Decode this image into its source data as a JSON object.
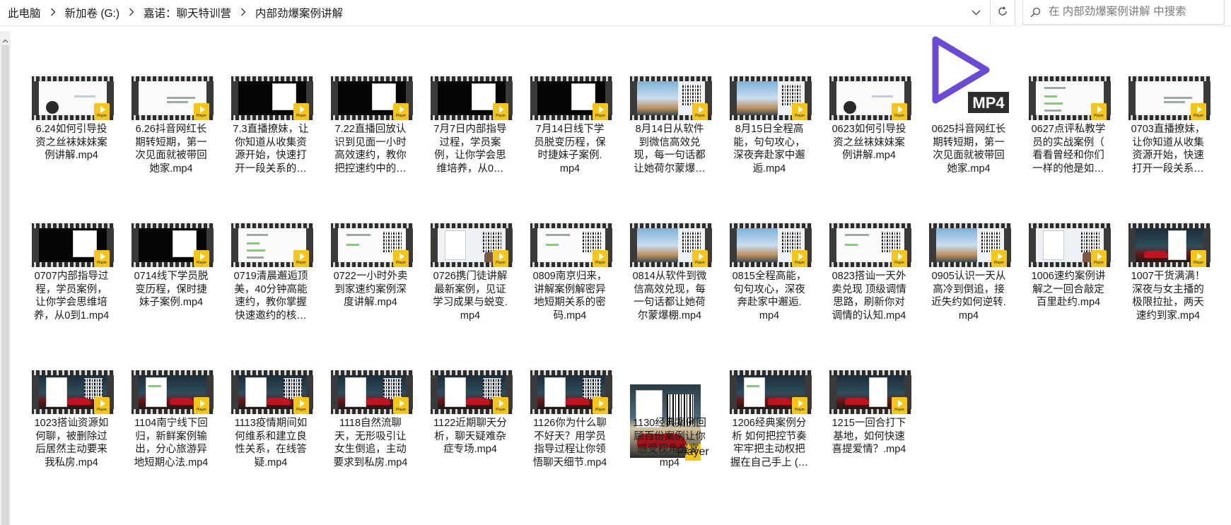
{
  "addressbar": {
    "breadcrumbs": [
      "此电脑",
      "新加卷 (G:)",
      "嘉诺：聊天特训营",
      "内部劲爆案例讲解"
    ],
    "search_placeholder": "在 内部劲爆案例讲解 中搜索"
  },
  "icons": {
    "separator": "chevron-right-icon",
    "dropdown": "chevron-down-icon",
    "refresh": "refresh-icon",
    "search": "search-icon",
    "file_badge": "player-badge-icon"
  },
  "colors": {
    "badge": "#f5c518",
    "mp4_icon": "#6b4bd6"
  },
  "files": [
    {
      "name": "6.24如何引导投资之丝袜妹妹案例讲解.mp4",
      "lines": [
        "6.24如何引导投",
        "资之丝袜妹妹案",
        "例讲解.mp4"
      ],
      "thumb": "white-face"
    },
    {
      "name": "6.26抖音网红长期转短期，第一次见面就被带回她家.mp4",
      "lines": [
        "6.26抖音网红长",
        "期转短期，第一",
        "次见面就被带回",
        "她家.mp4"
      ],
      "thumb": "white"
    },
    {
      "name": "7.3直播撩妹，让你知道从收集资源开始，快速打开一段关系的…",
      "lines": [
        "7.3直播撩妹，让",
        "你知道从收集资",
        "源开始，快速打",
        "开一段关系的…"
      ],
      "thumb": "black-panel"
    },
    {
      "name": "7.22直播回放认识到见面一小时高效速约，教你把控速约中的…",
      "lines": [
        "7.22直播回放认",
        "识到见面一小时",
        "高效速约，教你",
        "把控速约中的…"
      ],
      "thumb": "black-panel"
    },
    {
      "name": "7月7日内部指导过程，学员案例，让你学会思维培养，从0…",
      "lines": [
        "7月7日内部指导",
        "过程，学员案",
        "例，让你学会思",
        "维培养，从0…"
      ],
      "thumb": "black-panel"
    },
    {
      "name": "7月14日线下学员脱变历程，保时捷妹子案例.mp4",
      "lines": [
        "7月14日线下学",
        "员脱变历程，保",
        "时捷妹子案例.",
        "mp4"
      ],
      "thumb": "black-panel"
    },
    {
      "name": "8月14日从软件到微信高效兑现，每一句话都让她荷尔蒙爆…",
      "lines": [
        "8月14日从软件",
        "到微信高效兑",
        "现，每一句话都",
        "让她荷尔蒙爆…"
      ],
      "thumb": "sky-qr"
    },
    {
      "name": "8月15日全程高能，句句攻心，深夜奔赴家中邂逅.mp4",
      "lines": [
        "8月15日全程高",
        "能，句句攻心，",
        "深夜奔赴家中邂",
        "逅.mp4"
      ],
      "thumb": "sky-qr"
    },
    {
      "name": "0623如何引导投资之丝袜妹妹案例讲解.mp4",
      "lines": [
        "0623如何引导投",
        "资之丝袜妹妹案",
        "例讲解.mp4"
      ],
      "thumb": "white-face"
    },
    {
      "name": "0625抖音网红长期转短期，第一次见面就被带回她家.mp4",
      "lines": [
        "0625抖音网红长",
        "期转短期，第一",
        "次见面就被带回",
        "她家.mp4"
      ],
      "thumb": "mp4-icon",
      "mp4_label": "MP4"
    },
    {
      "name": "0627点评私教学员的实战案例（看看曾经和你们一样的他是如…",
      "lines": [
        "0627点评私教学",
        "员的实战案例（",
        "看看曾经和你们",
        "一样的他是如…"
      ],
      "thumb": "white-chat"
    },
    {
      "name": "0703直播撩妹，让你知道从收集资源开始，快速打开一段关系…",
      "lines": [
        "0703直播撩妹，",
        "让你知道从收集",
        "资源开始，快速",
        "打开一段关系…"
      ],
      "thumb": "white"
    },
    {
      "name": "0707内部指导过程，学员案例，让你学会思维培养，从0到1.mp4",
      "lines": [
        "0707内部指导过",
        "程，学员案例，",
        "让你学会思维培",
        "养，从0到1.mp4"
      ],
      "thumb": "black-panel"
    },
    {
      "name": "0714线下学员脱变历程，保时捷妹子案例.mp4",
      "lines": [
        "0714线下学员脱",
        "变历程，保时捷",
        "妹子案例.mp4"
      ],
      "thumb": "black-panel"
    },
    {
      "name": "0719清晨邂逅顶美，40分钟高能速约，教你掌握快速邀约的核…",
      "lines": [
        "0719清晨邂逅顶",
        "美，40分钟高能",
        "速约，教你掌握",
        "快速邀约的核…"
      ],
      "thumb": "white-chat"
    },
    {
      "name": "0722一小时外卖到家速约案例深度讲解.mp4",
      "lines": [
        "0722一小时外卖",
        "到家速约案例深",
        "度讲解.mp4"
      ],
      "thumb": "white-qr"
    },
    {
      "name": "0726携门徒讲解最新案例，见证学习成果与蜕变.mp4",
      "lines": [
        "0726携门徒讲解",
        "最新案例，见证",
        "学习成果与蜕变.",
        "mp4"
      ],
      "thumb": "screen-qr"
    },
    {
      "name": "0809南京归来，讲解案例解密异地短期关系的密码.mp4",
      "lines": [
        "0809南京归来，",
        "讲解案例解密异",
        "地短期关系的密",
        "码.mp4"
      ],
      "thumb": "white-qr"
    },
    {
      "name": "0814从软件到微信高效兑现，每一句话都让她荷尔蒙爆棚.mp4",
      "lines": [
        "0814从软件到微",
        "信高效兑现，每",
        "一句话都让她荷",
        "尔蒙爆棚.mp4"
      ],
      "thumb": "sky-qr"
    },
    {
      "name": "0815全程高能，句句攻心，深夜奔赴家中邂逅.mp4",
      "lines": [
        "0815全程高能，",
        "句句攻心，深夜",
        "奔赴家中邂逅.",
        "mp4"
      ],
      "thumb": "sky-qr"
    },
    {
      "name": "0823搭讪一天外卖兑现 顶级调情思路，刷新你对调情的认知.mp4",
      "lines": [
        "0823搭讪一天外",
        "卖兑现 顶级调情",
        "思路，刷新你对",
        "调情的认知.mp4"
      ],
      "thumb": "white-qr"
    },
    {
      "name": "0905认识一天从高冷到倒追，接近失约如何逆转.mp4",
      "lines": [
        "0905认识一天从",
        "高冷到倒追，接",
        "近失约如何逆转.",
        "mp4"
      ],
      "thumb": "sky-qr"
    },
    {
      "name": "1006速约案例讲解之一回合敲定百里赴约.mp4",
      "lines": [
        "1006速约案例讲",
        "解之一回合敲定",
        "百里赴约.mp4"
      ],
      "thumb": "screen-qr"
    },
    {
      "name": "1007干货满满！深夜与女主播的极限拉扯，两天速约到家.mp4",
      "lines": [
        "1007干货满满！",
        "深夜与女主播的",
        "极限拉扯，两天",
        "速约到家.mp4"
      ],
      "thumb": "car"
    },
    {
      "name": "1023搭讪资源如何聊，被删除过后居然主动要来我私房.mp4",
      "lines": [
        "1023搭讪资源如",
        "何聊，被删除过",
        "后居然主动要来",
        "我私房.mp4"
      ],
      "thumb": "car-qr"
    },
    {
      "name": "1104南宁线下回归，新鲜案例输出，分心旅游异地短期心法.mp4",
      "lines": [
        "1104南宁线下回",
        "归，新鲜案例输",
        "出，分心旅游异",
        "地短期心法.mp4"
      ],
      "thumb": "car-chat"
    },
    {
      "name": "1113疫情期间如何维系和建立良性关系，在线答疑.mp4",
      "lines": [
        "1113疫情期间如",
        "何维系和建立良",
        "性关系，在线答",
        "疑.mp4"
      ],
      "thumb": "car-qr"
    },
    {
      "name": "1118自然流聊天，无形吸引让女生倒追，主动要求到私房.mp4",
      "lines": [
        "1118自然流聊",
        "天，无形吸引让",
        "女生倒追，主动",
        "要求到私房.mp4"
      ],
      "thumb": "car-qr"
    },
    {
      "name": "1122近期聊天分析，聊天疑难杂症专场.mp4",
      "lines": [
        "1122近期聊天分",
        "析，聊天疑难杂",
        "症专场.mp4"
      ],
      "thumb": "car-qr"
    },
    {
      "name": "1126你为什么聊不好天？用学员指导过程让你领悟聊天细节.mp4",
      "lines": [
        "1126你为什么聊",
        "不好天？用学员",
        "指导过程让你领",
        "悟聊天细节.mp4"
      ],
      "thumb": "car-qr"
    },
    {
      "name": "1130经典案例回顾百份案例让你感受视角盛宴.mp4",
      "lines": [
        "1130经典案例回",
        "顾百份案例让你",
        "感受视角盛宴.",
        "mp4"
      ],
      "thumb": "big-frame"
    },
    {
      "name": "1206经典案例分析 如何把控节奏牢牢把主动权把握在自己手上（…",
      "lines": [
        "1206经典案例分",
        "析 如何把控节奏",
        "牢牢把主动权把",
        "握在自己手上 (…"
      ],
      "thumb": "car-chat"
    },
    {
      "name": "1215一回合打下基地，如何快速喜提爱情？.mp4",
      "lines": [
        "1215一回合打下",
        "基地，如何快速",
        "喜提爱情？.mp4"
      ],
      "thumb": "car"
    }
  ]
}
